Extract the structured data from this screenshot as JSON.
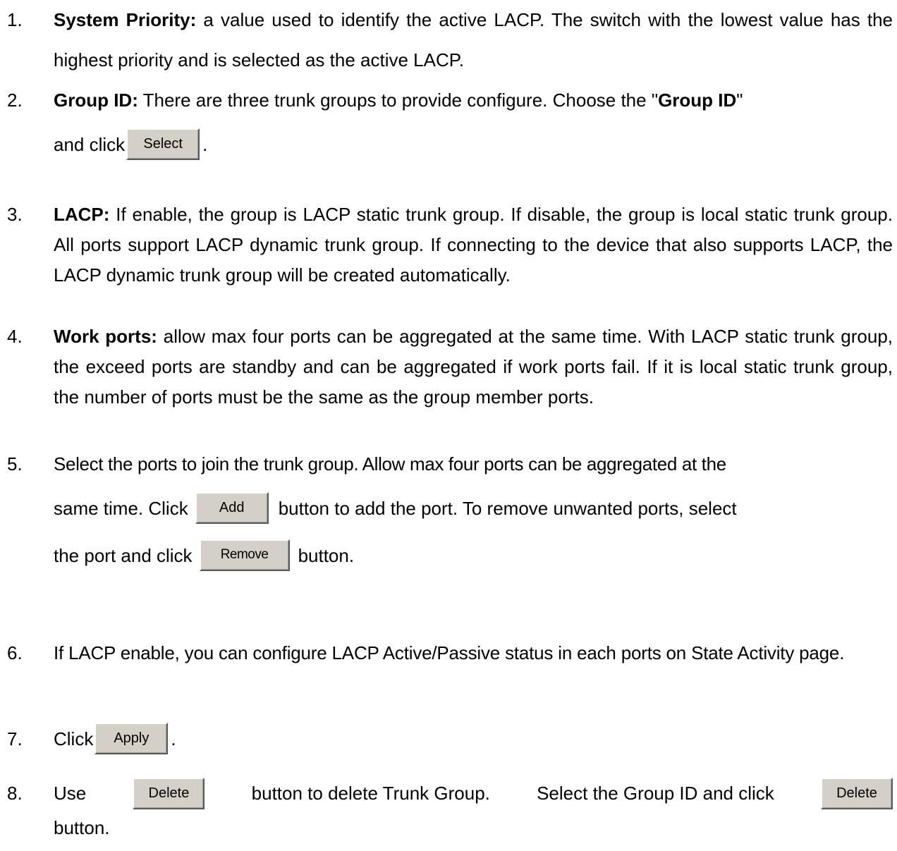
{
  "items": [
    {
      "num": "1.",
      "bold": "System Priority:",
      "text": " a value used to identify the active LACP. The switch with the lowest value has the highest priority and is selected as the active LACP."
    },
    {
      "num": "2.",
      "bold": "Group ID:",
      "text_a": " There are three trunk groups to provide configure. Choose the \"",
      "bold_b": "Group ID",
      "text_b": "\"",
      "text_c": "and click",
      "button": "Select",
      "text_d": "."
    },
    {
      "num": "3.",
      "bold": "LACP:",
      "text": " If enable, the group is LACP static trunk group. If disable, the group is local static trunk group. All ports support LACP dynamic trunk group. If connecting to the device that also supports LACP, the LACP dynamic trunk group will be created automatically."
    },
    {
      "num": "4.",
      "bold": "Work ports:",
      "text": " allow max four ports can be aggregated at the same time. With LACP static trunk group, the exceed ports are standby and can be aggregated if work ports fail. If it is local static trunk group, the number of ports must be the same as the group member ports."
    },
    {
      "num": "5.",
      "text_a": "Select the ports to join the trunk group. Allow max four ports can be aggregated at the same time. Click",
      "button_add": "Add",
      "text_b": "button to add the port. To remove unwanted ports, select the port and click",
      "button_remove": "Remove",
      "text_c": "button."
    },
    {
      "num": "6.",
      "text": "If LACP enable, you can configure LACP Active/Passive status in each ports on State Activity page."
    },
    {
      "num": "7.",
      "text_a": "Click",
      "button": "Apply",
      "text_b": "."
    },
    {
      "num": "8.",
      "text_a": "Use",
      "button_1": "Delete",
      "text_b": "button to delete Trunk Group. Select the Group ID and click",
      "button_2": "Delete",
      "text_c": "button."
    }
  ]
}
